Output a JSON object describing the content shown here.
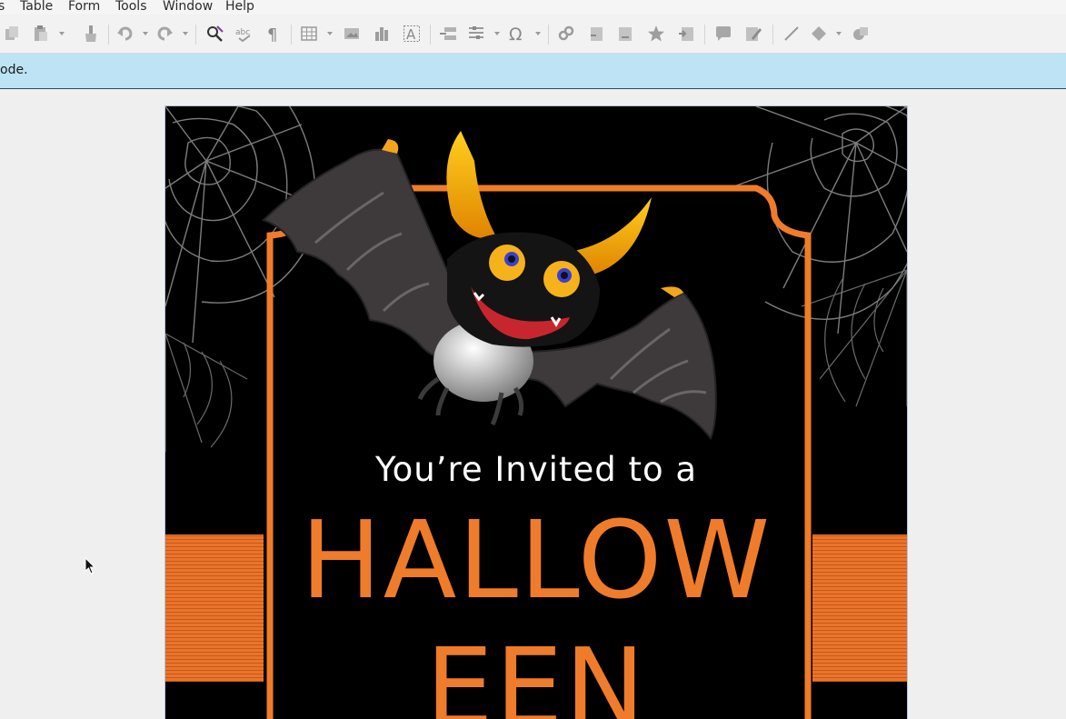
{
  "menubar": {
    "items": [
      "s",
      "Table",
      "Form",
      "Tools",
      "Window",
      "Help"
    ]
  },
  "toolbar": {
    "icons": [
      "copy-icon",
      "paste-icon",
      "clone-formatting-icon",
      "undo-icon",
      "redo-icon",
      "find-replace-icon",
      "spelling-icon",
      "formatting-marks-icon",
      "insert-table-icon",
      "insert-image-icon",
      "insert-chart-icon",
      "insert-textbox-icon",
      "insert-field-icon",
      "insert-special-character-icon",
      "insert-hyperlink-icon",
      "insert-footnote-icon",
      "insert-endnote-icon",
      "insert-bookmark-icon",
      "insert-cross-reference-icon",
      "insert-comment-icon",
      "track-changes-icon",
      "insert-line-icon",
      "basic-shapes-icon",
      "shapes-icon"
    ]
  },
  "infobar": {
    "text": "ode."
  },
  "document": {
    "invite_line": "You’re Invited to a",
    "title_line1": "HALLOW",
    "title_line2": "EEN"
  },
  "colors": {
    "accent_orange": "#ef7c2a",
    "page_background": "#000000",
    "infobar_background": "#bde3f5"
  }
}
